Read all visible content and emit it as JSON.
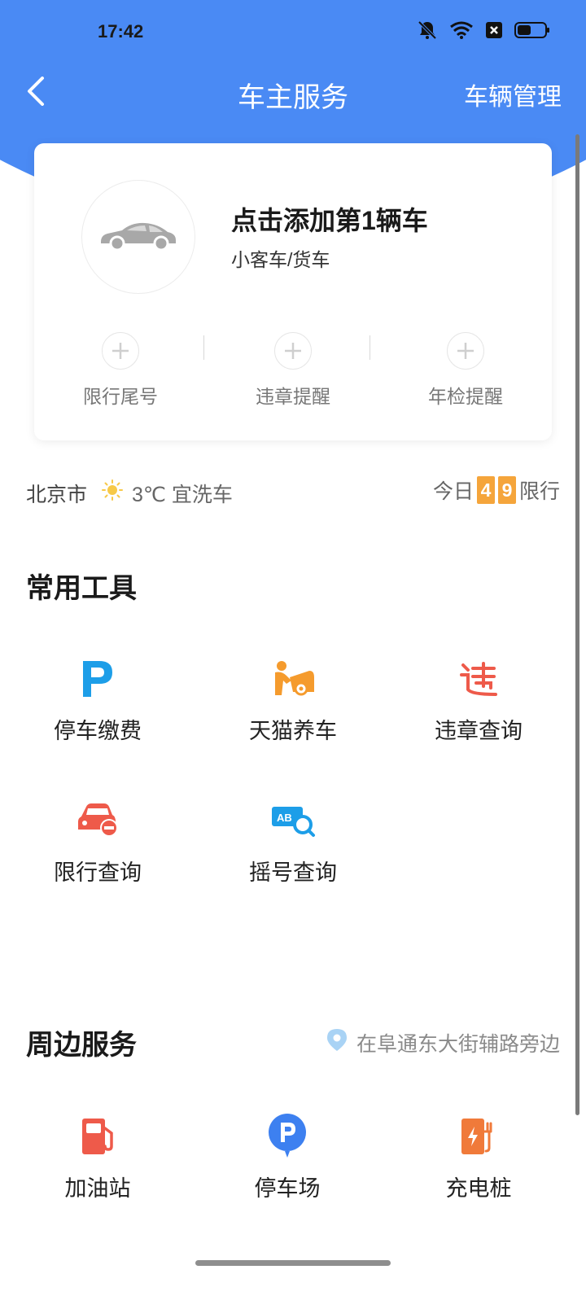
{
  "status_bar": {
    "time": "17:42"
  },
  "nav": {
    "title": "车主服务",
    "right_action": "车辆管理"
  },
  "vehicle_card": {
    "add_title": "点击添加第1辆车",
    "add_subtitle": "小客车/货车",
    "quick_items": [
      {
        "label": "限行尾号"
      },
      {
        "label": "违章提醒"
      },
      {
        "label": "年检提醒"
      }
    ]
  },
  "weather": {
    "city": "北京市",
    "condition": "3℃ 宜洗车",
    "limit_prefix": "今日",
    "limit_digits": [
      "4",
      "9"
    ],
    "limit_suffix": "限行"
  },
  "tools": {
    "title": "常用工具",
    "items": [
      {
        "label": "停车缴费",
        "icon": "parking-p-icon"
      },
      {
        "label": "天猫养车",
        "icon": "car-maintenance-icon"
      },
      {
        "label": "违章查询",
        "icon": "violation-icon"
      },
      {
        "label": "限行查询",
        "icon": "restricted-car-icon"
      },
      {
        "label": "摇号查询",
        "icon": "lottery-search-icon"
      }
    ]
  },
  "nearby": {
    "title": "周边服务",
    "location": "在阜通东大街辅路旁边",
    "items": [
      {
        "label": "加油站",
        "icon": "gas-station-icon"
      },
      {
        "label": "停车场",
        "icon": "parking-lot-icon"
      },
      {
        "label": "充电桩",
        "icon": "charging-pile-icon"
      }
    ]
  },
  "colors": {
    "primary": "#4a8af4",
    "orange": "#f5a53b",
    "red": "#ee5a4a"
  }
}
